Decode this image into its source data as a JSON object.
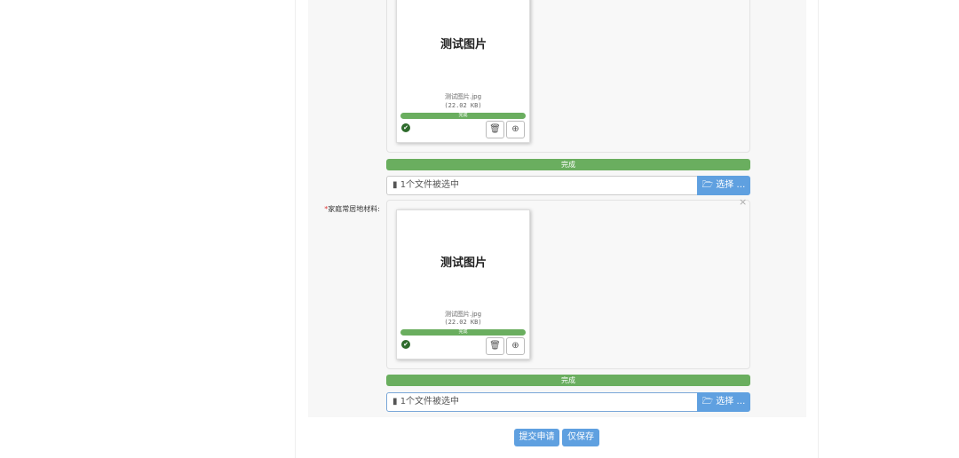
{
  "uploads": [
    {
      "label": "",
      "preview_text": "测试图片",
      "file_name": "测试图片.jpg",
      "file_size": "(22.02 KB)",
      "file_status": "完成",
      "progress_label": "完成",
      "progress_percent": 100,
      "input_text": "1个文件被选中",
      "choose_label": "选择 …"
    },
    {
      "label": "家庭常居地材料:",
      "required_mark": "*",
      "preview_text": "测试图片",
      "file_name": "测试图片.jpg",
      "file_size": "(22.02 KB)",
      "file_status": "完成",
      "progress_label": "完成",
      "progress_percent": 100,
      "input_text": "1个文件被选中",
      "choose_label": "选择 …"
    }
  ],
  "buttons": {
    "submit": "提交申请",
    "save": "仅保存"
  },
  "colors": {
    "success": "#6aae5f",
    "primary": "#5fa0e0"
  }
}
